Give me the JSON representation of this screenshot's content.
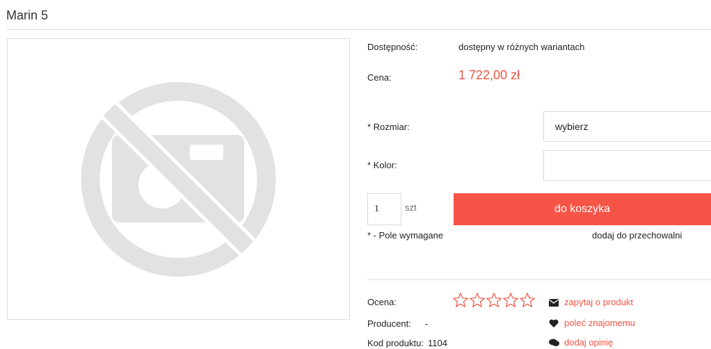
{
  "product": {
    "title": "Marin 5"
  },
  "details": {
    "availability_label": "Dostępność:",
    "availability_value": "dostępny w różnych wariantach",
    "price_label": "Cena:",
    "price_value": "1 722,00 zł",
    "size_label": "* Rozmiar:",
    "size_value": "wybierz",
    "color_label": "* Kolor:",
    "color_value": "",
    "quantity_value": "1",
    "quantity_unit": "szt",
    "add_to_cart_label": "do koszyka",
    "required_note": "* - Pole wymagane",
    "store_link": "dodaj do przechowalni"
  },
  "meta": {
    "rating_label": "Ocena:",
    "rating_value": 0,
    "rating_max": 5,
    "producer_label": "Producent:",
    "producer_value": "-",
    "code_label": "Kod produktu:",
    "code_value": "1104"
  },
  "actions": {
    "ask_label": "zapytaj o produkt",
    "recommend_label": "poleć znajomemu",
    "review_label": "dodaj opinię"
  },
  "colors": {
    "accent": "#f75448",
    "price": "#ef5340",
    "placeholder_gray": "#e2e2e2"
  },
  "icons": {
    "photo": "no-photo-icon",
    "ask": "envelope-icon",
    "recommend": "heart-icon",
    "review": "comments-icon",
    "rating": "star-outline-icon"
  }
}
